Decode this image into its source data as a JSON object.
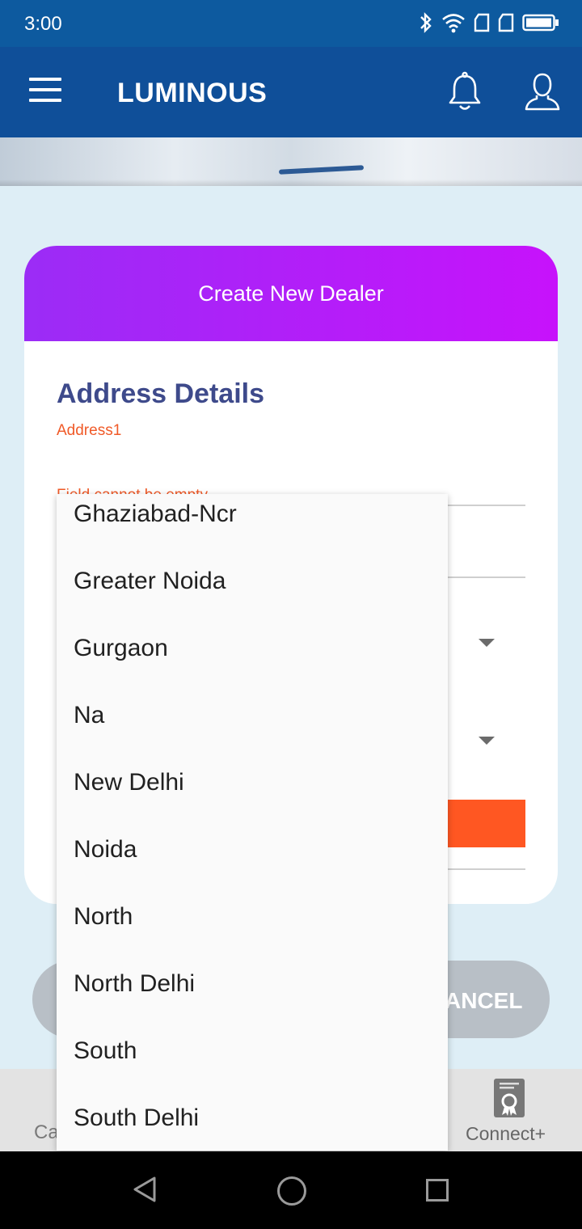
{
  "status_bar": {
    "time": "3:00"
  },
  "app_bar": {
    "title": "LUMINOUS"
  },
  "card": {
    "header_title": "Create New Dealer",
    "section_title": "Address Details",
    "address1_label": "Address1",
    "address1_error": "Field cannot be empty"
  },
  "buttons": {
    "cancel_label": "CANCEL",
    "cancel_visible": "ANCEL"
  },
  "bottom_nav": {
    "left_label_visible": "Ca",
    "right_label": "Connect+"
  },
  "dropdown": {
    "options": [
      "Ghaziabad-Ncr",
      "Greater Noida",
      "Gurgaon",
      "Na",
      "New Delhi",
      "Noida",
      "North",
      "North Delhi",
      "South",
      "South Delhi"
    ]
  },
  "colors": {
    "app_bar": "#0f4f99",
    "status_bar": "#0d5a9f",
    "header_gradient_start": "#9b2cf6",
    "header_gradient_end": "#c712fb",
    "accent_orange": "#ff5722",
    "section_title": "#3e4a8b"
  },
  "icons": {
    "menu": "hamburger-menu-icon",
    "bell": "bell-icon",
    "user": "user-icon",
    "certificate": "certificate-icon"
  }
}
